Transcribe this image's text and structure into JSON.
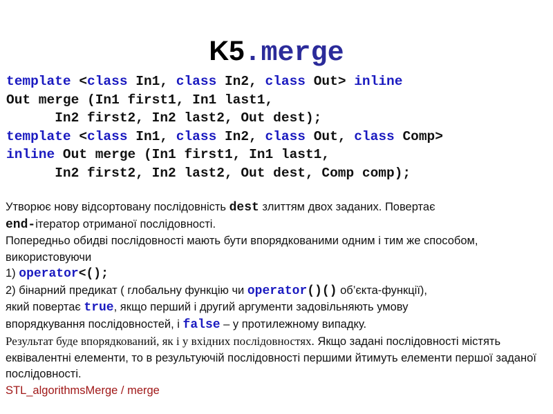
{
  "title": {
    "main": "K5",
    "suffix": ".merge"
  },
  "code": {
    "lines": [
      {
        "parts": [
          {
            "t": "template",
            "kw": true
          },
          {
            "t": " <"
          },
          {
            "t": "class",
            "kw": true
          },
          {
            "t": " In1, "
          },
          {
            "t": "class",
            "kw": true
          },
          {
            "t": " In2, "
          },
          {
            "t": "class",
            "kw": true
          },
          {
            "t": " Out> "
          },
          {
            "t": "inline",
            "kw": true
          }
        ]
      },
      {
        "parts": [
          {
            "t": "Out merge (In1 first1, In1 last1,"
          }
        ]
      },
      {
        "parts": [
          {
            "t": "      In2 first2, In2 last2, Out dest);"
          }
        ]
      },
      {
        "parts": [
          {
            "t": "template",
            "kw": true
          },
          {
            "t": " <"
          },
          {
            "t": "class",
            "kw": true
          },
          {
            "t": " In1, "
          },
          {
            "t": "class",
            "kw": true
          },
          {
            "t": " In2, "
          },
          {
            "t": "class",
            "kw": true
          },
          {
            "t": " Out, "
          },
          {
            "t": "class",
            "kw": true
          },
          {
            "t": " Comp>"
          }
        ]
      },
      {
        "parts": [
          {
            "t": "inline",
            "kw": true
          },
          {
            "t": " Out merge (In1 first1, In1 last1,"
          }
        ]
      },
      {
        "parts": [
          {
            "t": "      In2 first2, In2 last2, Out dest, Comp comp);"
          }
        ]
      }
    ]
  },
  "description": {
    "p1": {
      "a": "Утворює нову відсортовану послідовність ",
      "code": "dest",
      "b": " злиттям двох заданих. Повертає "
    },
    "p1b": {
      "code": "end-",
      "b": "ітератор отриманої послідовності."
    },
    "p2": "Попередньо  обидві  послідовності мають бути впорядкованими  одним і тим же способом, використовуючи",
    "item1": {
      "prefix": "1) ",
      "code": "operator",
      "code2": "<();"
    },
    "item2": {
      "a": "2) бінарний предикат ( глобальну функцію чи ",
      "code": "operator",
      "code2": "()()",
      "b": "  об’єкта-функції),"
    },
    "item2b": {
      "a": "який повертає ",
      "code": "true",
      "b": ", якщо перший і другий аргументи задовільняють умову"
    },
    "item2c": {
      "a": "впорядкування послідовностей, і ",
      "code": "false",
      "b": "  – у протилежному випадку."
    },
    "result": {
      "serif": "Результат буде впорядкований, як і у вхідних послідовностях.",
      "rest": " Якщо задані послідовності містять еквівалентні елементи, то в результуючій послідовності  першими йтимуть елементи першої заданої послідовності."
    },
    "link": "STL_algorithmsMerge / merge"
  }
}
